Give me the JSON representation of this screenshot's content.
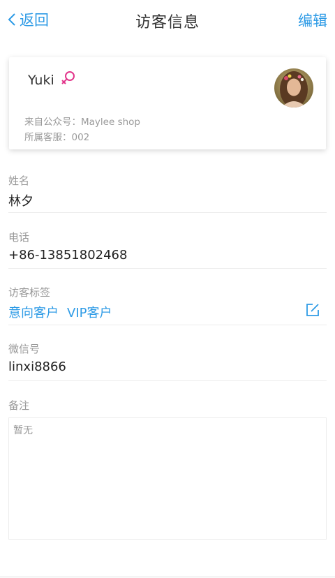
{
  "nav": {
    "back_label": "返回",
    "title": "访客信息",
    "edit_label": "编辑"
  },
  "profile": {
    "name": "Yuki",
    "gender": "female",
    "gender_icon": "female-symbol-icon",
    "gender_color": "#e2368b",
    "source_line": "来自公众号：Maylee shop",
    "agent_line": "所属客服：002",
    "avatar": "avatar-photo"
  },
  "fields": {
    "name": {
      "label": "姓名",
      "value": "林夕"
    },
    "phone": {
      "label": "电话",
      "value": "+86-13851802468"
    },
    "tags": {
      "label": "访客标签",
      "items": [
        "意向客户",
        "VIP客户"
      ],
      "edit_icon": "edit-icon"
    },
    "wechat": {
      "label": "微信号",
      "value": "linxi8866"
    },
    "notes": {
      "label": "备注",
      "placeholder": "暂无"
    }
  },
  "colors": {
    "accent": "#2e9be6",
    "label_gray": "#999999"
  }
}
